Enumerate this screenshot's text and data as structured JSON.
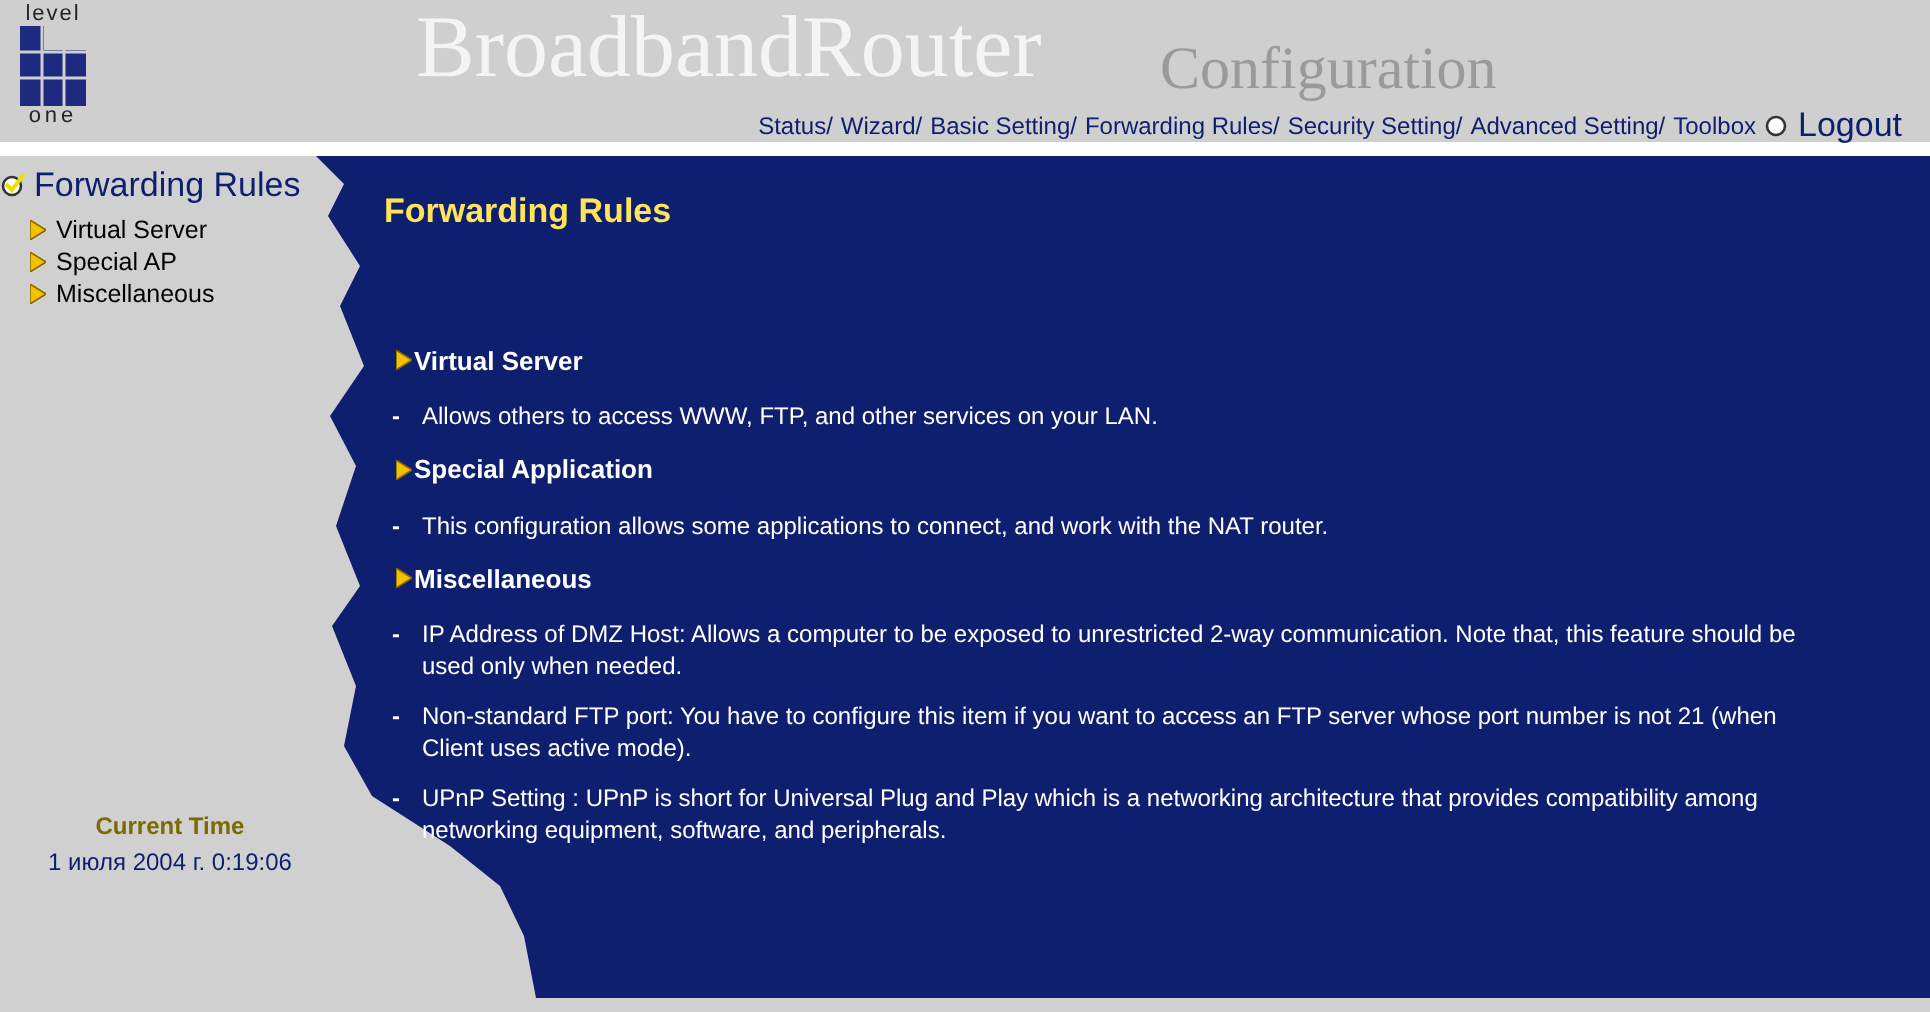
{
  "logo": {
    "top": "level",
    "bottom": "one"
  },
  "header": {
    "title": "BroadbandRouter",
    "subtitle": "Configuration",
    "nav": [
      "Status/",
      "Wizard/",
      "Basic Setting/",
      "Forwarding Rules/",
      "Security Setting/",
      "Advanced Setting/",
      "Toolbox"
    ],
    "logout": "Logout"
  },
  "sidebar": {
    "section": {
      "label": "Forwarding Rules",
      "selected": true
    },
    "items": [
      {
        "label": "Virtual Server",
        "selected": false
      },
      {
        "label": "Special AP",
        "selected": false
      },
      {
        "label": "Miscellaneous",
        "selected": false
      }
    ],
    "time_label": "Current Time",
    "time_value": "1 июля 2004 г. 0:19:06"
  },
  "content": {
    "title": "Forwarding Rules",
    "sections": [
      {
        "heading": "Virtual Server",
        "items": [
          {
            "bullet": "-",
            "text": "Allows others to access WWW, FTP, and other services on your LAN."
          }
        ]
      },
      {
        "heading": "Special Application",
        "items": [
          {
            "bullet": "-",
            "text": "This configuration allows some applications to connect, and work with the NAT router."
          }
        ]
      },
      {
        "heading": "Miscellaneous",
        "items": [
          {
            "bullet": "-",
            "text": "IP Address of DMZ Host: Allows a computer to be exposed to unrestricted 2-way communication. Note that, this feature should be used only when needed."
          },
          {
            "bullet": "-",
            "text": "Non-standard FTP port: You have to configure this item if you want to access an FTP server whose port number is not 21 (when Client uses active mode)."
          },
          {
            "bullet": "-",
            "text": "UPnP Setting : UPnP is short for Universal Plug and Play which is a networking architecture that provides compatibility among networking equipment, software, and peripherals."
          }
        ]
      }
    ]
  }
}
